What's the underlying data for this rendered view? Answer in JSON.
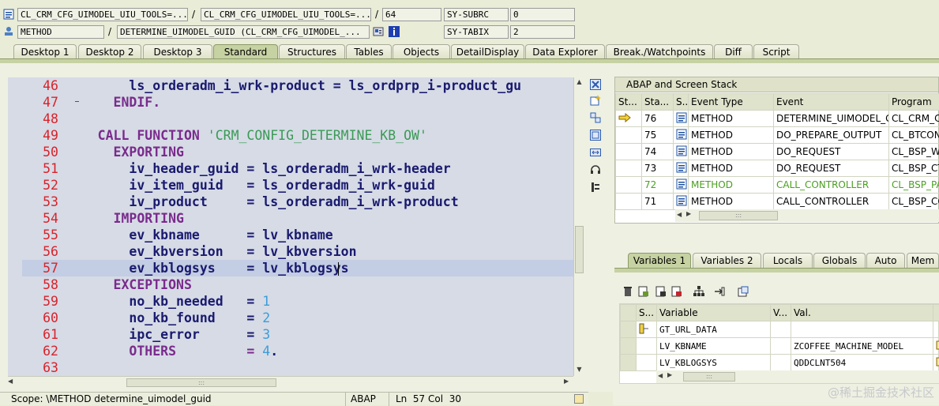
{
  "header": {
    "row1": {
      "field1": "CL_CRM_CFG_UIMODEL_UIU_TOOLS=...",
      "sep1": "/",
      "field2": "CL_CRM_CFG_UIMODEL_UIU_TOOLS=...",
      "sep2": "/",
      "field3": "64",
      "sys_label": "SY-SUBRC",
      "sys_value": "0"
    },
    "row2": {
      "field1": "METHOD",
      "sep1": "/",
      "field2": "DETERMINE_UIMODEL_GUID (CL_CRM_CFG_UIMODEL_...",
      "sys_label": "SY-TABIX",
      "sys_value": "2"
    }
  },
  "tabs": [
    {
      "label": "Desktop 1"
    },
    {
      "label": "Desktop 2"
    },
    {
      "label": "Desktop 3"
    },
    {
      "label": "Standard"
    },
    {
      "label": "Structures"
    },
    {
      "label": "Tables"
    },
    {
      "label": "Objects"
    },
    {
      "label": "DetailDisplay"
    },
    {
      "label": "Data Explorer"
    },
    {
      "label": "Break./Watchpoints"
    },
    {
      "label": "Diff"
    },
    {
      "label": "Script"
    }
  ],
  "active_tab": "Standard",
  "code": {
    "lines": [
      {
        "n": "46",
        "t": "      ls_orderadm_i_wrk-product = ls_ordprp_i-product_gu"
      },
      {
        "n": "47",
        "t": "    ENDIF."
      },
      {
        "n": "48",
        "t": ""
      },
      {
        "n": "49",
        "t": "  CALL FUNCTION "
      },
      {
        "n": "50",
        "t": "    EXPORTING"
      },
      {
        "n": "51",
        "t": "      iv_header_guid = ls_orderadm_i_wrk-header"
      },
      {
        "n": "52",
        "t": "      iv_item_guid   = ls_orderadm_i_wrk-guid"
      },
      {
        "n": "53",
        "t": "      iv_product     = ls_orderadm_i_wrk-product"
      },
      {
        "n": "54",
        "t": "    IMPORTING"
      },
      {
        "n": "55",
        "t": "      ev_kbname      = lv_kbname"
      },
      {
        "n": "56",
        "t": "      ev_kbversion   = lv_kbversion"
      },
      {
        "n": "57",
        "t": "      ev_kblogsys    = lv_kblogsys"
      },
      {
        "n": "58",
        "t": "    EXCEPTIONS"
      },
      {
        "n": "59",
        "t": "      no_kb_needed   = "
      },
      {
        "n": "60",
        "t": "      no_kb_found    = "
      },
      {
        "n": "61",
        "t": "      ipc_error      = "
      },
      {
        "n": "62",
        "t": "      OTHERS         = "
      },
      {
        "n": "63",
        "t": ""
      }
    ],
    "fm_name": "'CRM_CONFIG_DETERMINE_KB_OW'",
    "exc_values": [
      "1",
      "2",
      "3",
      "4"
    ],
    "exc_suffix": "."
  },
  "status": {
    "scope": "Scope: \\METHOD determine_uimodel_guid",
    "lang": "ABAP",
    "pos": "Ln  57 Col  30"
  },
  "stack": {
    "title": "ABAP and Screen Stack",
    "columns": [
      "St...",
      "Sta...",
      "S...",
      "Event Type",
      "Event",
      "Program"
    ],
    "rows": [
      {
        "level": "76",
        "type": "METHOD",
        "event": "DETERMINE_UIMODEL_G...",
        "program": "CL_CRM_CF"
      },
      {
        "level": "75",
        "type": "METHOD",
        "event": "DO_PREPARE_OUTPUT",
        "program": "CL_BTCONF"
      },
      {
        "level": "74",
        "type": "METHOD",
        "event": "DO_REQUEST",
        "program": "CL_BSP_WD"
      },
      {
        "level": "73",
        "type": "METHOD",
        "event": "DO_REQUEST",
        "program": "CL_BSP_CT"
      },
      {
        "level": "72",
        "type": "METHOD",
        "event": "CALL_CONTROLLER",
        "program": "CL_BSP_PA"
      },
      {
        "level": "71",
        "type": "METHOD",
        "event": "CALL_CONTROLLER",
        "program": "CL_BSP_CO"
      }
    ],
    "scroll_dots": ":::"
  },
  "vartabs": [
    {
      "label": "Variables 1"
    },
    {
      "label": "Variables 2"
    },
    {
      "label": "Locals"
    },
    {
      "label": "Globals"
    },
    {
      "label": "Auto"
    },
    {
      "label": "Mem"
    }
  ],
  "vars": {
    "columns": [
      "S...",
      "Variable",
      "V...",
      "Val."
    ],
    "rows": [
      {
        "name": "GT_URL_DATA",
        "value": ""
      },
      {
        "name": "LV_KBNAME",
        "value": "ZCOFFEE_MACHINE_MODEL"
      },
      {
        "name": "LV_KBLOGSYS",
        "value": "QDDCLNT504"
      }
    ],
    "scroll_dots": ":::"
  },
  "editor_scroll_dots": ":::",
  "watermark": "@稀土掘金技术社区",
  "colors": {
    "accent": "#c7d2a3",
    "background": "#e9ecd6",
    "editor_bg": "#d6dbe6"
  }
}
